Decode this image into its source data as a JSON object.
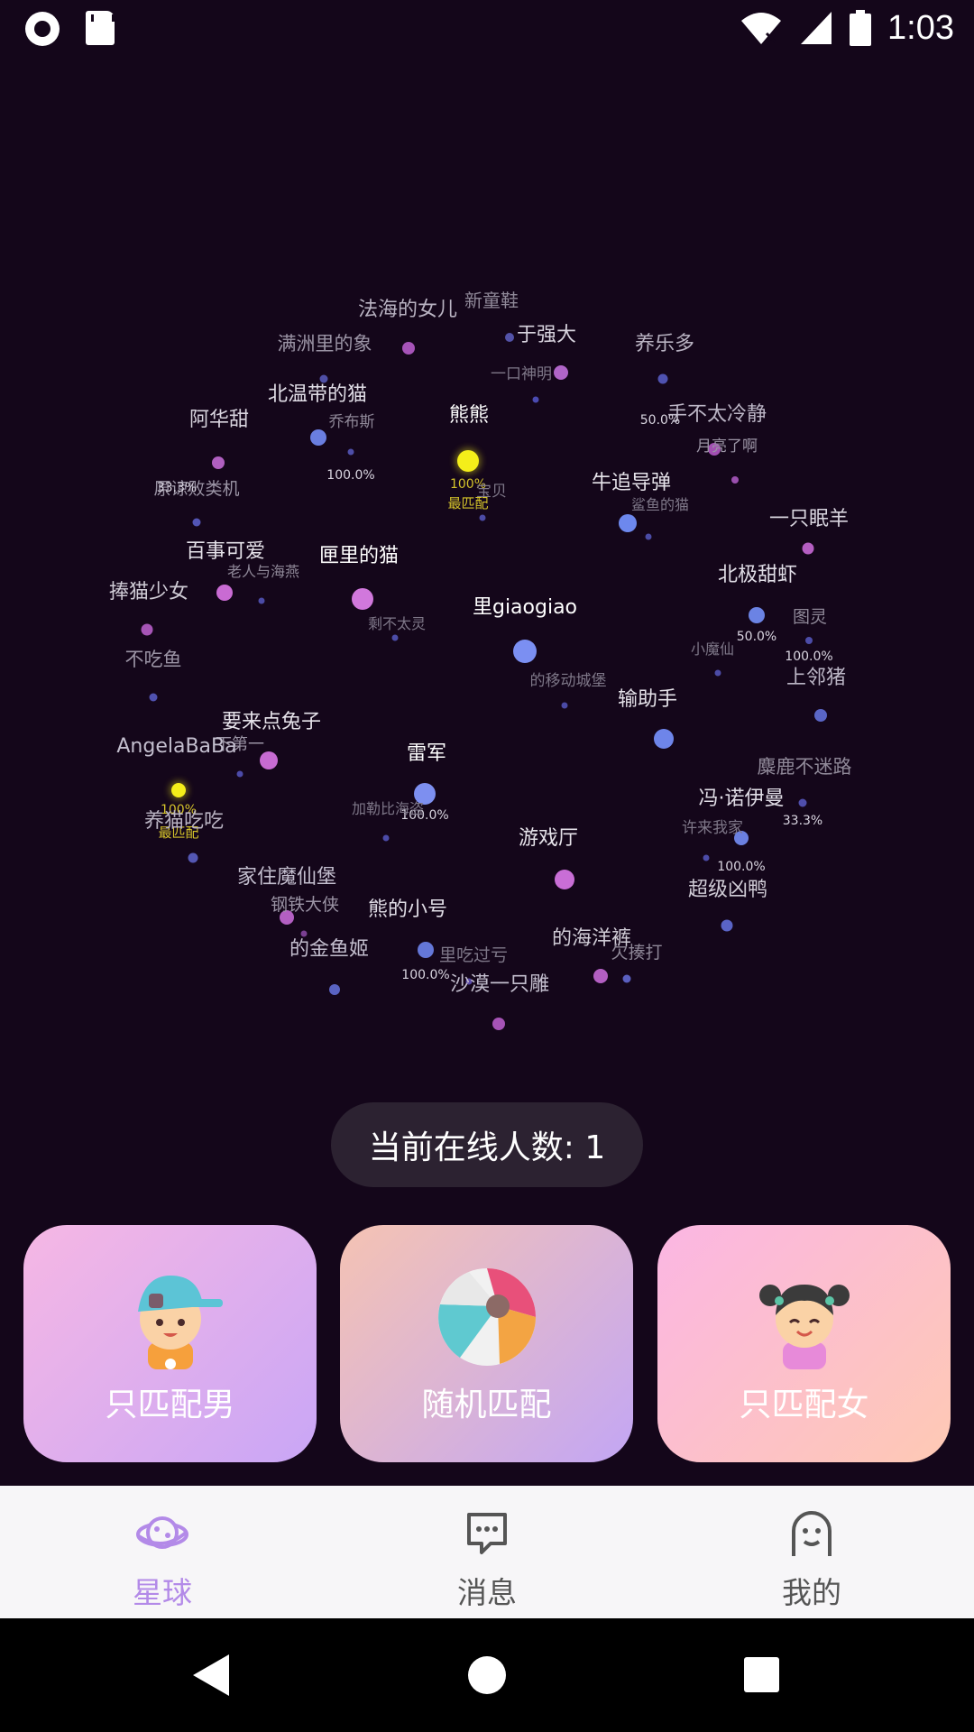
{
  "status_bar": {
    "time": "1:03",
    "icons": [
      "screen-record-icon",
      "sd-card-icon",
      "wifi-off-icon",
      "signal-icon",
      "battery-icon"
    ]
  },
  "planet": {
    "users": [
      {
        "name": "法海的女儿",
        "dot_color": "#a653b8"
      },
      {
        "name": "新童鞋",
        "dot_color": "#5352a8"
      },
      {
        "name": "于强大",
        "dot_color": "#b065c8"
      },
      {
        "name": "养乐多",
        "dot_color": "#4f52b0"
      },
      {
        "name": "满洲里的象",
        "dot_color": "#4f4fa6"
      },
      {
        "name": "一口神明",
        "dot_color": "#4a4ab0"
      },
      {
        "name": "北温带的猫",
        "dot_color": "#6a7ee0"
      },
      {
        "name": "乔布斯",
        "dot_color": "#4e4ea8",
        "percent": "100.0%"
      },
      {
        "name": "熊熊",
        "dot_color": "#f4ee1a",
        "percent": "100%",
        "tag": "最匹配"
      },
      {
        "name": "阿华甜",
        "dot_color": "#b05fc0"
      },
      {
        "name": "手不太冷静",
        "dot_color": "#a24fb2",
        "percent": "50.0%"
      },
      {
        "name": "月亮了啊",
        "dot_color": "#9a4fae"
      },
      {
        "name": "原谅败类机",
        "dot_color": "#5355b5",
        "percent": "33.3%"
      },
      {
        "name": "宝贝",
        "dot_color": "#4c4ba5"
      },
      {
        "name": "牛追导弹",
        "dot_color": "#6d88ee"
      },
      {
        "name": "鲨鱼的猫",
        "dot_color": "#4b4ca6"
      },
      {
        "name": "一只眠羊",
        "dot_color": "#b55ec2"
      },
      {
        "name": "百事可爱",
        "dot_color": "#c96bd3"
      },
      {
        "name": "老人与海燕",
        "dot_color": "#4b4ba6"
      },
      {
        "name": "匣里的猫",
        "dot_color": "#d178dc"
      },
      {
        "name": "捧猫少女",
        "dot_color": "#a655b6"
      },
      {
        "name": "北极甜虾",
        "dot_color": "#6b83e4",
        "percent": "50.0%"
      },
      {
        "name": "图灵",
        "dot_color": "#4c4ca8",
        "percent": "100.0%"
      },
      {
        "name": "里giaogiao",
        "dot_color": "#7b8ff2"
      },
      {
        "name": "剩不太灵",
        "dot_color": "#4c4ca8"
      },
      {
        "name": "不吃鱼",
        "dot_color": "#5052b0"
      },
      {
        "name": "小魔仙",
        "dot_color": "#4c4ba6"
      },
      {
        "name": "上邻猪",
        "dot_color": "#5a66c6"
      },
      {
        "name": "的移动城堡",
        "dot_color": "#4b4aa6"
      },
      {
        "name": "输助手",
        "dot_color": "#6e85ea"
      },
      {
        "name": "要来点兔子",
        "dot_color": "#c76bd2"
      },
      {
        "name": "下第一",
        "dot_color": "#4c4aa8"
      },
      {
        "name": "AngelaBaBa",
        "dot_color": "#f4ee1a",
        "percent": "100%",
        "tag": "最匹配"
      },
      {
        "name": "雷军",
        "dot_color": "#7d8ff0",
        "percent": "100.0%"
      },
      {
        "name": "麋鹿不迷路",
        "dot_color": "#4f4eab",
        "percent": "33.3%"
      },
      {
        "name": "冯·诺伊曼",
        "dot_color": "#6b80e0",
        "percent": "100.0%"
      },
      {
        "name": "养猫吃吃",
        "dot_color": "#5457b3"
      },
      {
        "name": "加勒比海盗",
        "dot_color": "#4c4ba8"
      },
      {
        "name": "许来我家",
        "dot_color": "#4c4ba8"
      },
      {
        "name": "游戏厅",
        "dot_color": "#c96ed6"
      },
      {
        "name": "家住魔仙堡",
        "dot_color": "#b35fc2"
      },
      {
        "name": "钢铁大侠",
        "dot_color": "#7a3f92"
      },
      {
        "name": "超级凶鸭",
        "dot_color": "#5a64c6"
      },
      {
        "name": "熊的小号",
        "dot_color": "#6477d8",
        "percent": "100.0%"
      },
      {
        "name": "的金鱼姬",
        "dot_color": "#5a63c2"
      },
      {
        "name": "里吃过亏",
        "dot_color": "#5a4aa8"
      },
      {
        "name": "的海洋裤",
        "dot_color": "#b35fc2"
      },
      {
        "name": "欠揍打",
        "dot_color": "#5a5fc0"
      },
      {
        "name": "沙漠一只雕",
        "dot_color": "#a653b6"
      }
    ]
  },
  "online": {
    "label": "当前在线人数: 1"
  },
  "cards": {
    "male": {
      "label": "只匹配男",
      "icon": "boy-avatar-icon"
    },
    "random": {
      "label": "随机匹配",
      "icon": "beach-ball-icon"
    },
    "female": {
      "label": "只匹配女",
      "icon": "girl-avatar-icon"
    }
  },
  "tabs": [
    {
      "label": "星球",
      "icon": "planet-icon",
      "active": true
    },
    {
      "label": "消息",
      "icon": "message-icon",
      "active": false
    },
    {
      "label": "我的",
      "icon": "profile-icon",
      "active": false
    }
  ],
  "colors": {
    "background": "#14061a",
    "accent": "#b38ae8",
    "highlight": "#f4ee1a"
  }
}
